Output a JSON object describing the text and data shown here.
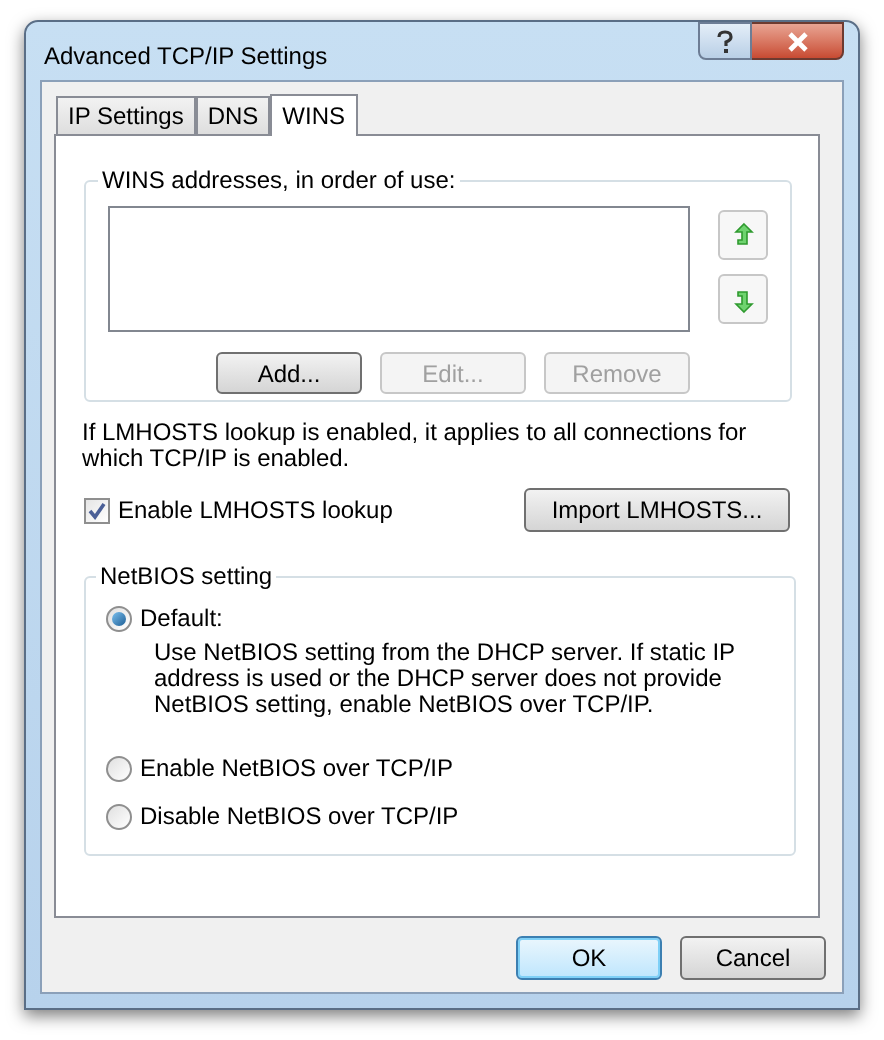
{
  "window": {
    "title": "Advanced TCP/IP Settings"
  },
  "tabs": [
    {
      "label": "IP Settings",
      "selected": false
    },
    {
      "label": "DNS",
      "selected": false
    },
    {
      "label": "WINS",
      "selected": true
    }
  ],
  "wins_group": {
    "legend": "WINS addresses, in order of use:",
    "buttons": [
      {
        "label": "Add...",
        "disabled": false
      },
      {
        "label": "Edit...",
        "disabled": true
      },
      {
        "label": "Remove",
        "disabled": true
      }
    ]
  },
  "note": "If LMHOSTS lookup is enabled, it applies to all connections for which TCP/IP is enabled.",
  "lmhosts_checkbox": {
    "label": "Enable LMHOSTS lookup",
    "checked": true
  },
  "import_button": {
    "label": "Import LMHOSTS..."
  },
  "netbios_group": {
    "legend": "NetBIOS setting",
    "options": [
      {
        "label": "Default:",
        "selected": true,
        "description": "Use NetBIOS setting from the DHCP server. If static IP address is used or the DHCP server does not provide NetBIOS setting, enable NetBIOS over TCP/IP."
      },
      {
        "label": "Enable NetBIOS over TCP/IP",
        "selected": false
      },
      {
        "label": "Disable NetBIOS over TCP/IP",
        "selected": false
      }
    ]
  },
  "dialog_buttons": [
    {
      "label": "OK",
      "kind": "default"
    },
    {
      "label": "Cancel",
      "kind": "normal"
    }
  ]
}
